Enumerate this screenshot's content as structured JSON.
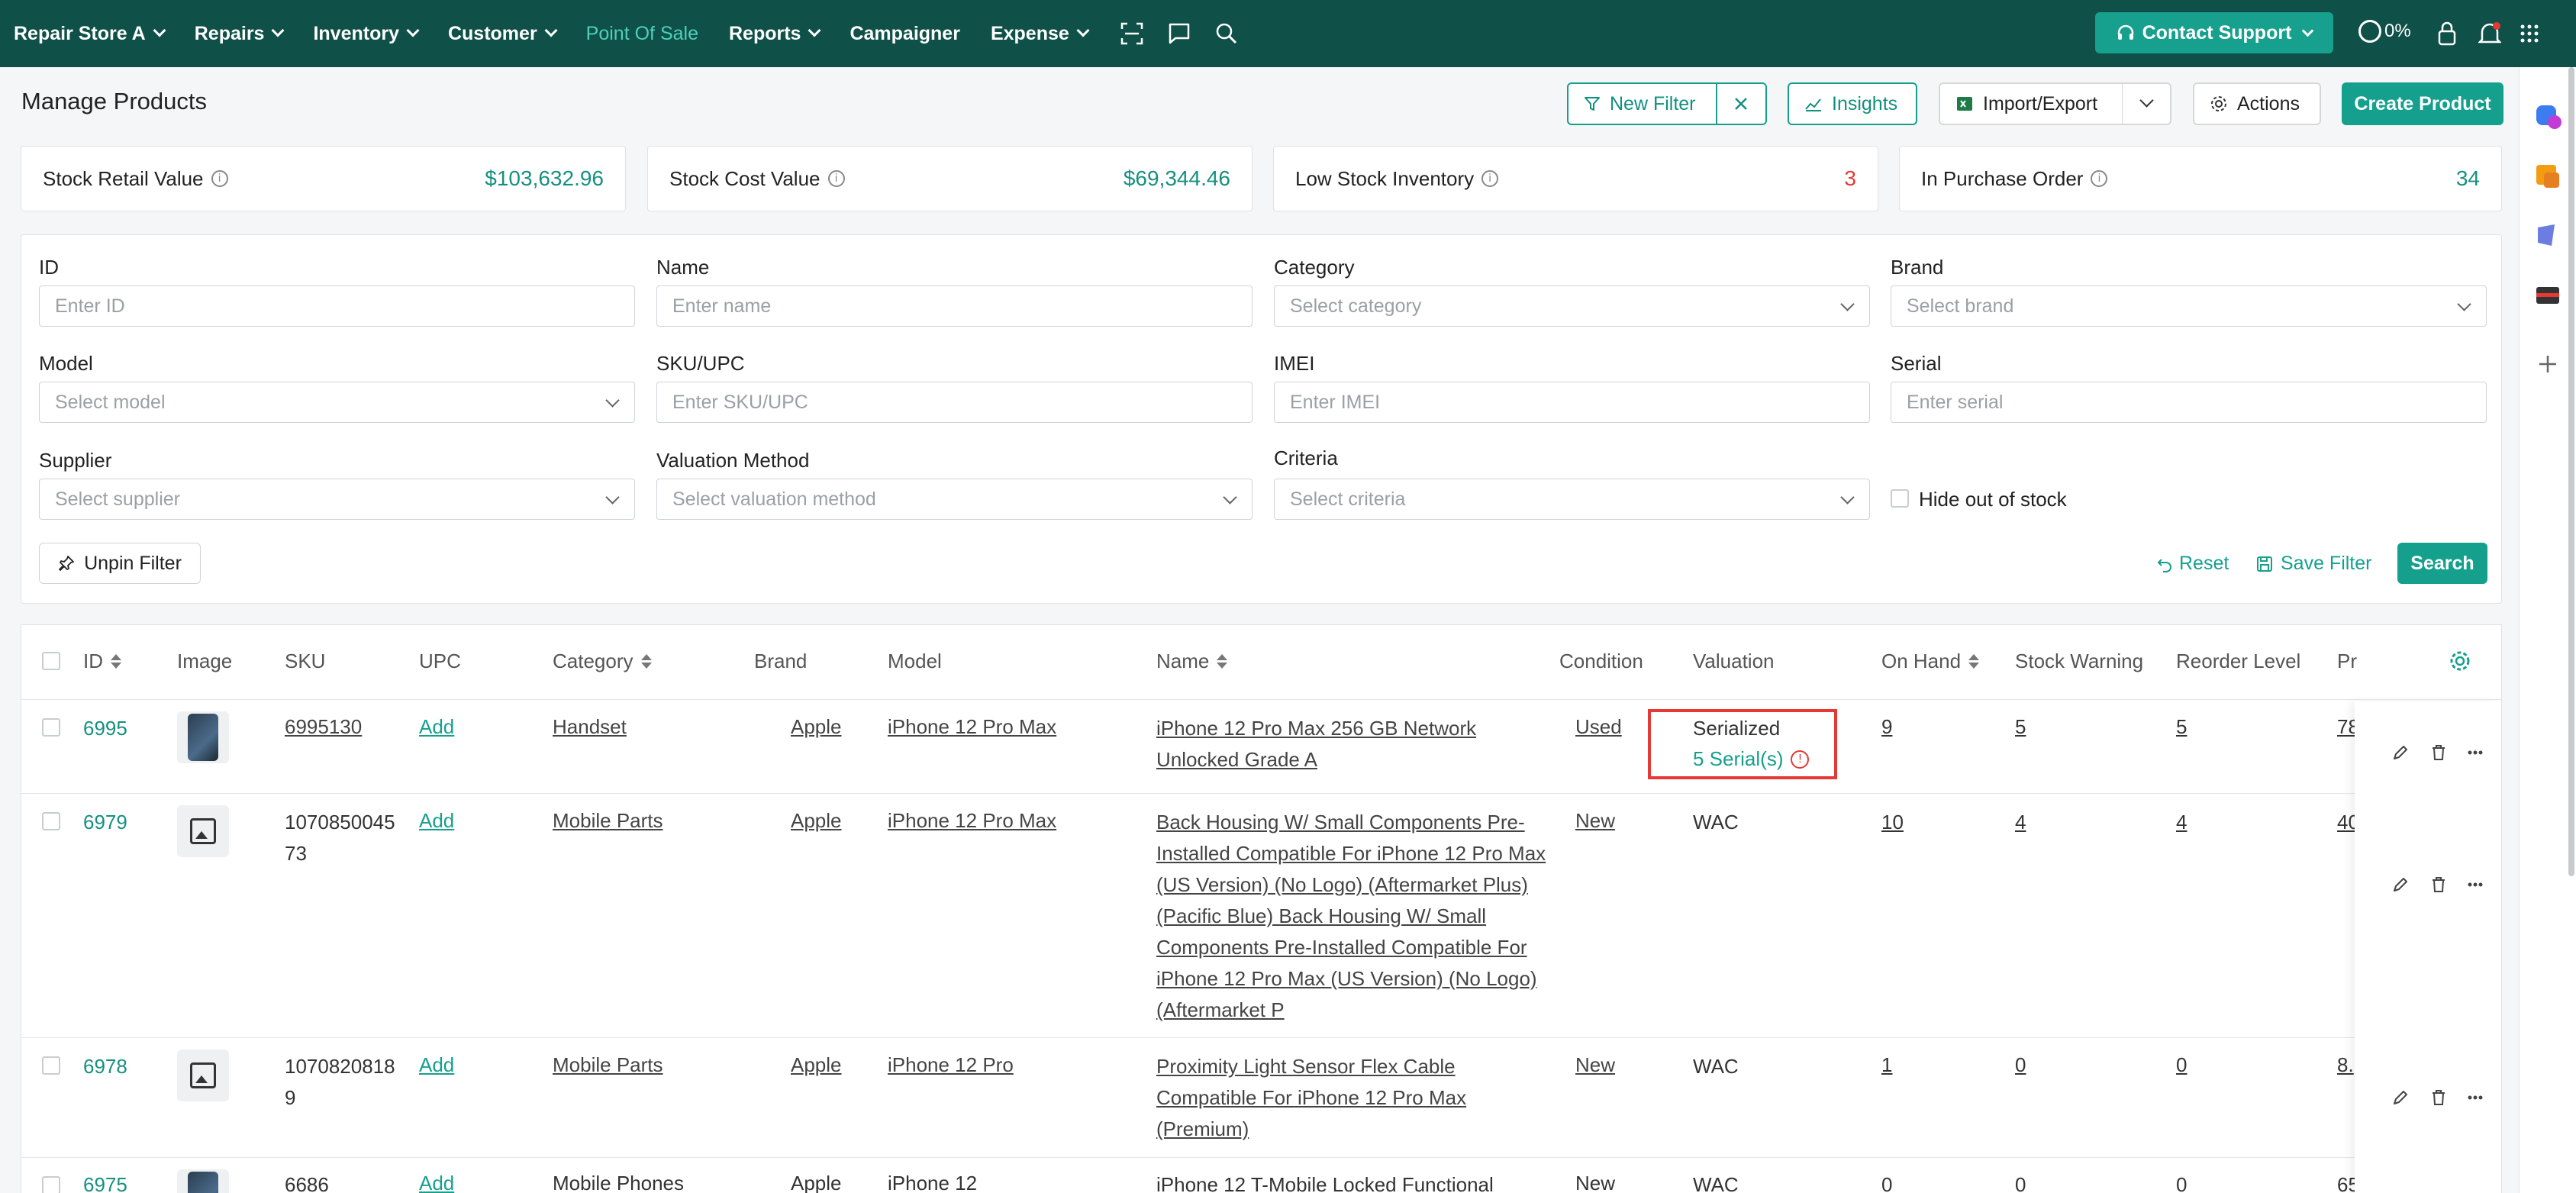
{
  "nav": {
    "items": [
      {
        "label": "Repair Store A",
        "chevron": true
      },
      {
        "label": "Repairs",
        "chevron": true
      },
      {
        "label": "Inventory",
        "chevron": true
      },
      {
        "label": "Customer",
        "chevron": true
      },
      {
        "label": "Point Of Sale",
        "chevron": false,
        "active": true
      },
      {
        "label": "Reports",
        "chevron": true
      },
      {
        "label": "Campaigner",
        "chevron": false
      },
      {
        "label": "Expense",
        "chevron": true
      }
    ],
    "contact_support": "Contact Support",
    "progress": "0%"
  },
  "page": {
    "title": "Manage Products",
    "new_filter": "New Filter",
    "insights": "Insights",
    "import_export": "Import/Export",
    "actions": "Actions",
    "create_product": "Create Product"
  },
  "stats": [
    {
      "label": "Stock Retail Value",
      "value": "$103,632.96"
    },
    {
      "label": "Stock Cost Value",
      "value": "$69,344.46"
    },
    {
      "label": "Low Stock Inventory",
      "value": "3"
    },
    {
      "label": "In Purchase Order",
      "value": "34"
    }
  ],
  "filters": {
    "id": {
      "label": "ID",
      "placeholder": "Enter ID"
    },
    "name": {
      "label": "Name",
      "placeholder": "Enter name"
    },
    "category": {
      "label": "Category",
      "placeholder": "Select category"
    },
    "brand": {
      "label": "Brand",
      "placeholder": "Select brand"
    },
    "model": {
      "label": "Model",
      "placeholder": "Select model"
    },
    "sku": {
      "label": "SKU/UPC",
      "placeholder": "Enter SKU/UPC"
    },
    "imei": {
      "label": "IMEI",
      "placeholder": "Enter IMEI"
    },
    "serial": {
      "label": "Serial",
      "placeholder": "Enter serial"
    },
    "supplier": {
      "label": "Supplier",
      "placeholder": "Select supplier"
    },
    "valuation": {
      "label": "Valuation Method",
      "placeholder": "Select valuation method"
    },
    "criteria": {
      "label": "Criteria",
      "placeholder": "Select criteria"
    },
    "hide_out_of_stock": "Hide out of stock",
    "unpin": "Unpin Filter",
    "reset": "Reset",
    "save_filter": "Save Filter",
    "search": "Search"
  },
  "table": {
    "headers": {
      "id": "ID",
      "image": "Image",
      "sku": "SKU",
      "upc": "UPC",
      "category": "Category",
      "brand": "Brand",
      "model": "Model",
      "name": "Name",
      "condition": "Condition",
      "valuation": "Valuation",
      "on_hand": "On Hand",
      "stock_warning": "Stock Warning",
      "reorder_level": "Reorder Level",
      "price": "Pr"
    },
    "rows": [
      {
        "id": "6995",
        "sku": "6995130",
        "upc": "Add",
        "category": "Handset",
        "brand": "Apple",
        "model": "iPhone 12 Pro Max",
        "name": [
          "iPhone 12 Pro Max 256 GB Network",
          "Unlocked Grade A"
        ],
        "condition": "Used",
        "valuation": "Serialized",
        "serials": "5 Serial(s)",
        "on_hand": "9",
        "stock_warning": "5",
        "reorder_level": "5",
        "price": "78"
      },
      {
        "id": "6979",
        "sku": [
          "1070850045",
          "73"
        ],
        "upc": "Add",
        "category": "Mobile Parts",
        "brand": "Apple",
        "model": "iPhone 12 Pro Max",
        "name": [
          "Back Housing W/ Small Components Pre-",
          "Installed Compatible For iPhone 12 Pro Max",
          "(US Version) (No Logo) (Aftermarket Plus)",
          "(Pacific Blue)  Back Housing W/ Small",
          "Components Pre-Installed Compatible For",
          "iPhone 12 Pro Max (US Version) (No Logo)",
          "(Aftermarket P"
        ],
        "condition": "New",
        "valuation": "WAC",
        "on_hand": "10",
        "stock_warning": "4",
        "reorder_level": "4",
        "price": "40"
      },
      {
        "id": "6978",
        "sku": [
          "1070820818",
          "9"
        ],
        "upc": "Add",
        "category": "Mobile Parts",
        "brand": "Apple",
        "model": "iPhone 12 Pro",
        "name": [
          "Proximity Light Sensor Flex Cable",
          "Compatible For iPhone 12 Pro Max",
          "(Premium)"
        ],
        "condition": "New",
        "valuation": "WAC",
        "on_hand": "1",
        "stock_warning": "0",
        "reorder_level": "0",
        "price": "8."
      },
      {
        "id": "6975",
        "sku": [
          "6686"
        ],
        "upc": "Add",
        "category": "Mobile Phones",
        "brand": "Apple",
        "model": "iPhone 12",
        "name": [
          "iPhone 12  T-Mobile Locked  Functional"
        ],
        "condition": "New",
        "valuation": "WAC",
        "on_hand": "0",
        "stock_warning": "0",
        "reorder_level": "0",
        "price": "65"
      }
    ]
  },
  "colors": {
    "brand_dark": "#0f5049",
    "accent": "#15a08e",
    "alert": "#e53935"
  }
}
